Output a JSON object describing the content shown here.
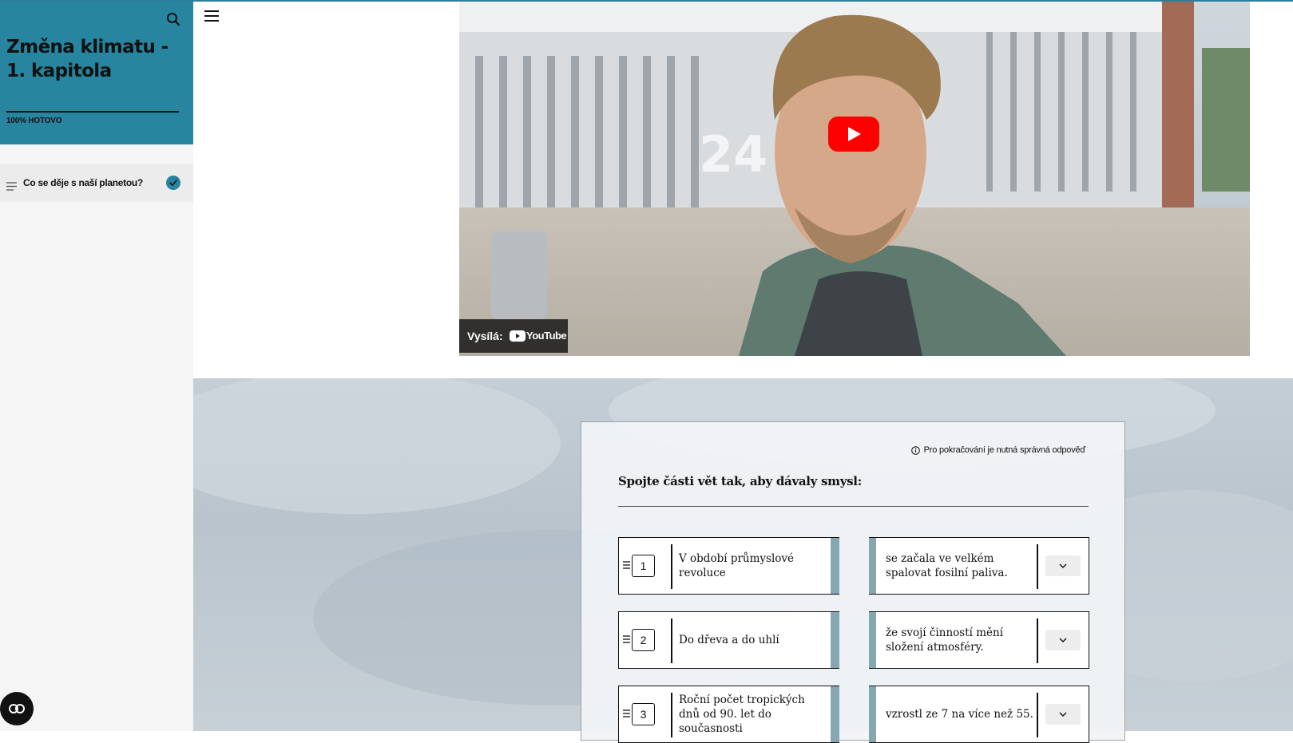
{
  "course": {
    "title": "Změna klimatu - 1. kapitola",
    "progress_percent": 100,
    "progress_label": "100% HOTOVO"
  },
  "sidebar": {
    "lessons": [
      {
        "label": "Co se děje s naší planetou?",
        "completed": true
      }
    ]
  },
  "video": {
    "provider_prefix": "Vysílá:",
    "provider_name": "YouTube",
    "play_button_color": "#ff0000"
  },
  "quiz": {
    "notice": "Pro pokračování je nutná správná odpověď",
    "question": "Spojte části vět tak, aby dávaly smysl:",
    "pairs": [
      {
        "number": "1",
        "left": "V období průmyslové revoluce",
        "right": "se začala ve velkém spalovat fosilní paliva."
      },
      {
        "number": "2",
        "left": "Do dřeva a do uhlí",
        "right": "že svojí činností mění složení atmosféry."
      },
      {
        "number": "3",
        "left": "Roční počet tropických dnů od 90. let do současnosti",
        "right": "vzrostl ze 7 na více než 55."
      }
    ]
  },
  "colors": {
    "accent": "#27859f",
    "match_bar": "#86a7b2"
  },
  "icons": {
    "search": "search-icon",
    "menu": "hamburger-menu-icon",
    "lesson": "lesson-lines-icon",
    "check": "check-icon",
    "accessibility": "accessibility-icon",
    "info": "info-icon",
    "grip": "drag-grip-icon",
    "chevron": "chevron-down-icon"
  }
}
